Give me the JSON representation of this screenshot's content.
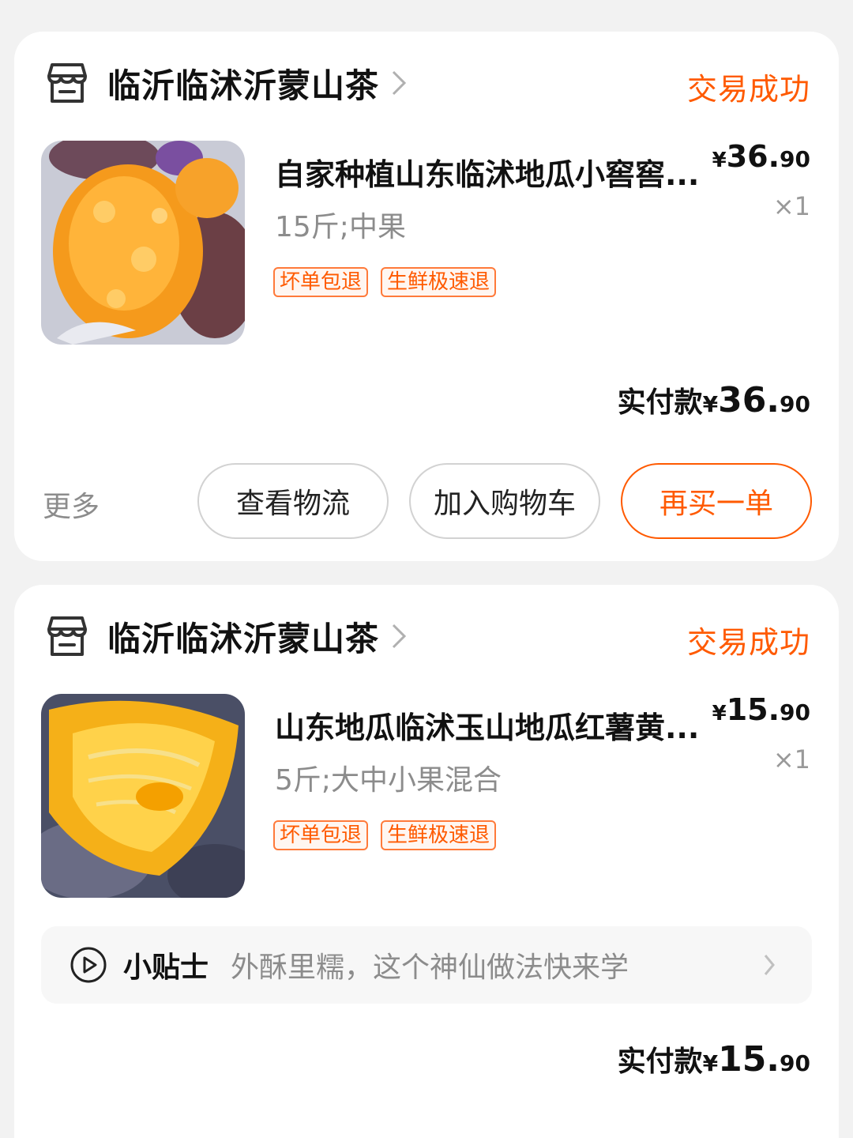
{
  "colors": {
    "accent": "#ff5a00",
    "muted": "#8c8c8c",
    "bg": "#f2f2f2"
  },
  "orders": [
    {
      "shop_name": "临沂临沭沂蒙山茶",
      "status": "交易成功",
      "product_title": "自家种植山东临沭地瓜小窖窖...",
      "price_currency": "¥",
      "price_int": "36.",
      "price_dec": "90",
      "quantity": "×1",
      "sku": "15斤;中果",
      "tags": [
        "坏单包退",
        "生鲜极速退"
      ],
      "paid_label": "实付款",
      "paid_currency": "¥",
      "paid_int": "36.",
      "paid_dec": "90",
      "more_label": "更多",
      "buttons": {
        "logistics": "查看物流",
        "add_cart": "加入购物车",
        "rebuy": "再买一单"
      }
    },
    {
      "shop_name": "临沂临沭沂蒙山茶",
      "status": "交易成功",
      "product_title": "山东地瓜临沭玉山地瓜红薯黄...",
      "price_currency": "¥",
      "price_int": "15.",
      "price_dec": "90",
      "quantity": "×1",
      "sku": "5斤;大中小果混合",
      "tags": [
        "坏单包退",
        "生鲜极速退"
      ],
      "tip_label": "小贴士",
      "tip_text": "外酥里糯，这个神仙做法快来学",
      "paid_label": "实付款",
      "paid_currency": "¥",
      "paid_int": "15.",
      "paid_dec": "90"
    }
  ],
  "icons": [
    "shop-icon",
    "chevron-right-icon",
    "play-circle-icon"
  ]
}
